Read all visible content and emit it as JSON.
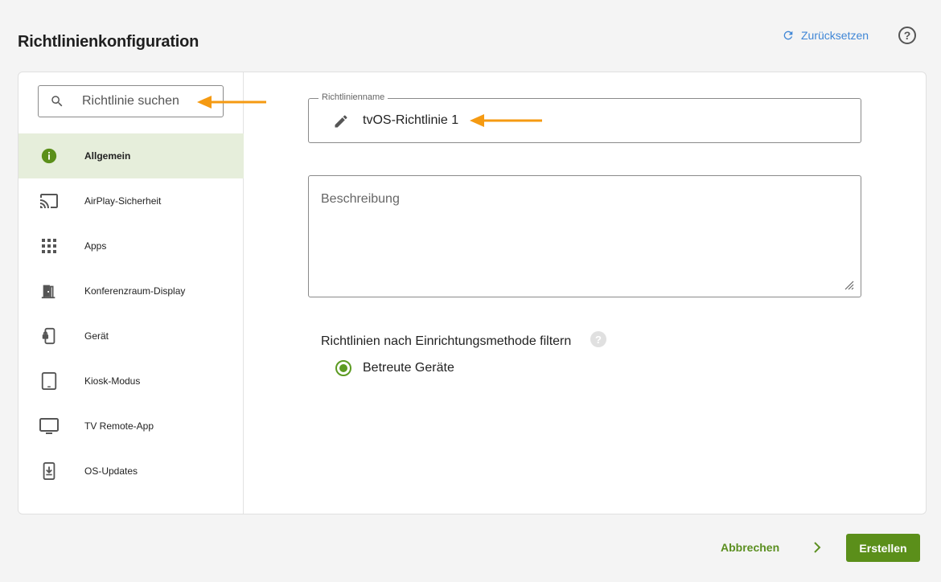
{
  "header": {
    "title": "Richtlinienkonfiguration",
    "reset_label": "Zurücksetzen",
    "help_glyph": "?"
  },
  "sidebar": {
    "search_placeholder": "Richtlinie suchen",
    "items": [
      {
        "label": "Allgemein",
        "icon": "info-icon",
        "active": true
      },
      {
        "label": "AirPlay-Sicherheit",
        "icon": "cast-icon"
      },
      {
        "label": "Apps",
        "icon": "apps-grid-icon"
      },
      {
        "label": "Konferenzraum-Display",
        "icon": "door-icon"
      },
      {
        "label": "Gerät",
        "icon": "device-lock-icon"
      },
      {
        "label": "Kiosk-Modus",
        "icon": "tablet-icon"
      },
      {
        "label": "TV Remote-App",
        "icon": "monitor-icon"
      },
      {
        "label": "OS-Updates",
        "icon": "system-update-icon"
      }
    ]
  },
  "form": {
    "name_label": "Richtlinienname",
    "name_value": "tvOS-Richtlinie 1",
    "description_placeholder": "Beschreibung",
    "filter_label": "Richtlinien nach Einrichtungsmethode filtern",
    "filter_help_glyph": "?",
    "radio_option": "Betreute Geräte"
  },
  "footer": {
    "cancel_label": "Abbrechen",
    "create_label": "Erstellen"
  },
  "colors": {
    "accent_green": "#5b8f1a",
    "link_blue": "#3f86d6",
    "annotation_orange": "#f59a12",
    "active_bg": "#e6eedb"
  }
}
